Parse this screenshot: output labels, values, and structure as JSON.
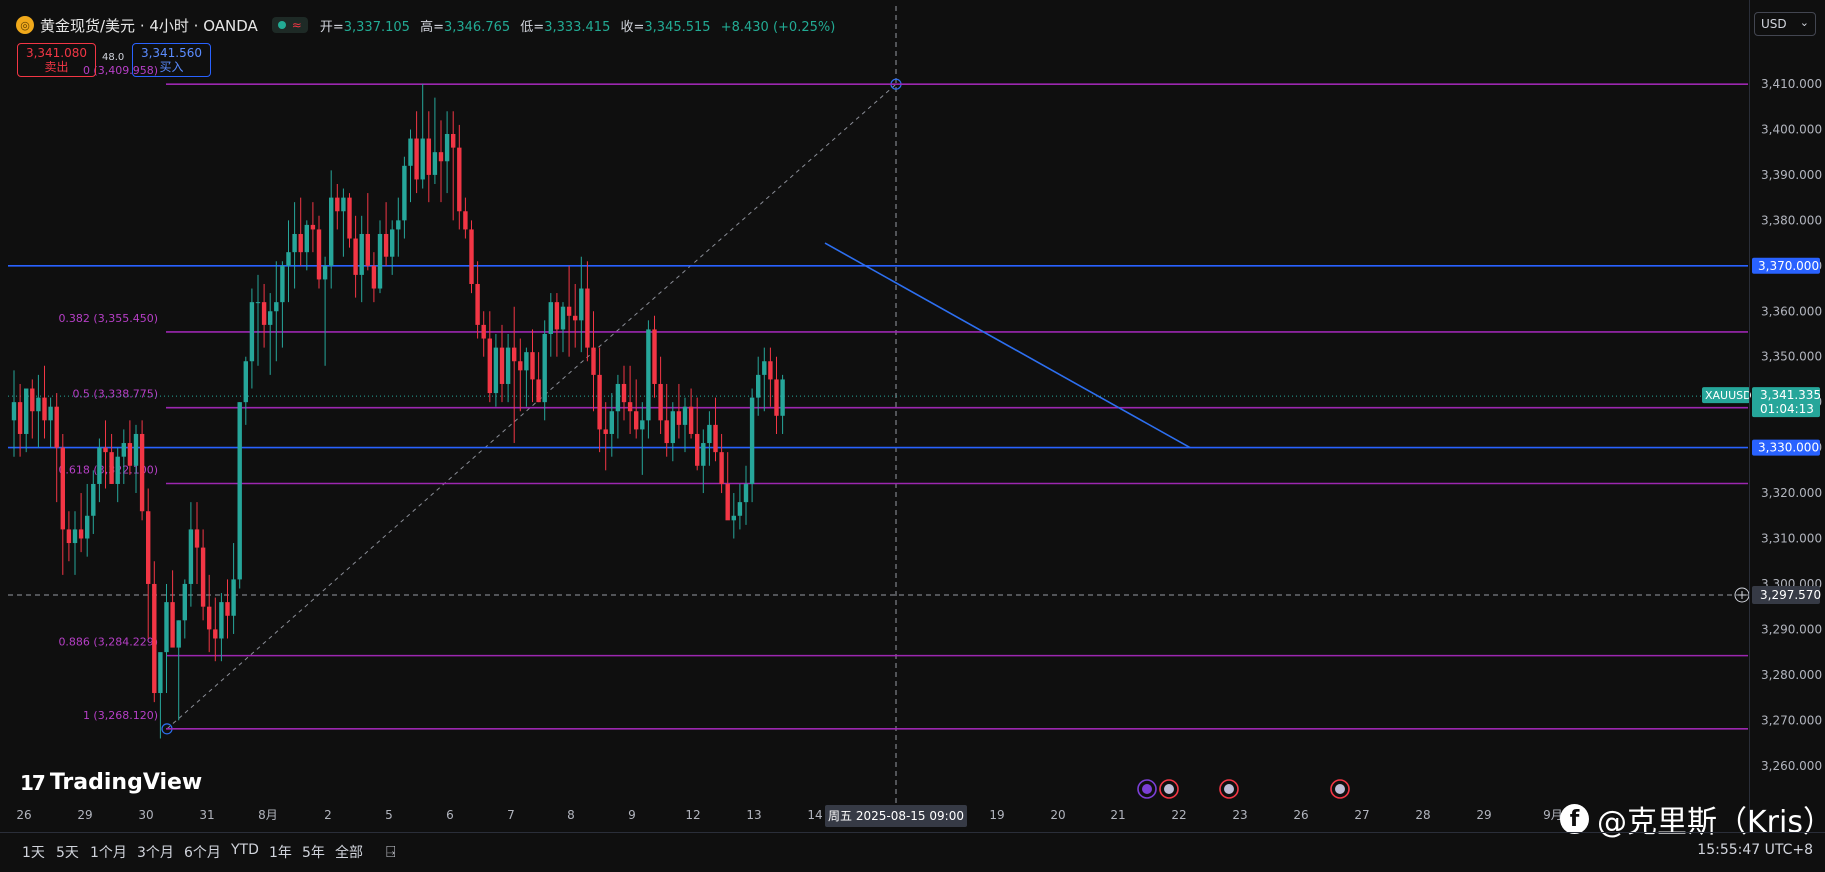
{
  "header": {
    "symbol_title": "黄金现货/美元 · 4小时 · OANDA",
    "ohlc": [
      {
        "label": "开=",
        "value": "3,337.105"
      },
      {
        "label": "高=",
        "value": "3,346.765"
      },
      {
        "label": "低=",
        "value": "3,333.415"
      },
      {
        "label": "收=",
        "value": "3,345.515"
      },
      {
        "label": "",
        "value": "+8.430 (+0.25%)"
      }
    ]
  },
  "trade": {
    "sell_price": "3,341.080",
    "sell_label": "卖出",
    "spread": "48.0",
    "buy_price": "3,341.560",
    "buy_label": "买入"
  },
  "currency": "USD",
  "timeframes": [
    "1天",
    "5天",
    "1个月",
    "3个月",
    "6个月",
    "YTD",
    "1年",
    "5年",
    "全部"
  ],
  "clock": "15:55:47 UTC+8",
  "branding": {
    "logo_text": "TradingView",
    "logo_mark": "17"
  },
  "watermark": "@克里斯（Kris）",
  "colors": {
    "up": "#26a69a",
    "down": "#f23645",
    "fib": "#9c27b0",
    "level": "#2962ff",
    "trend": "#2d6ff0"
  },
  "chart_data": {
    "type": "candlestick",
    "symbol": "XAUUSD",
    "interval": "4h",
    "y_axis": {
      "ticks": [
        "3,260.000",
        "3,270.000",
        "3,280.000",
        "3,290.000",
        "3,300.000",
        "3,310.000",
        "3,320.000",
        "3,330.000",
        "3,340.000",
        "3,350.000",
        "3,360.000",
        "3,370.000",
        "3,380.000",
        "3,390.000",
        "3,400.000",
        "3,410.000"
      ],
      "range": [
        3255,
        3415
      ]
    },
    "x_axis": {
      "labels": [
        "26",
        "29",
        "30",
        "31",
        "8月",
        "2",
        "5",
        "6",
        "7",
        "8",
        "9",
        "12",
        "13",
        "14",
        "19",
        "20",
        "21",
        "22",
        "23",
        "26",
        "27",
        "28",
        "29",
        "9月"
      ],
      "crosshair_label": "周五 2025-08-15   09:00"
    },
    "fib_levels": [
      {
        "label": "0 (3,409.958)",
        "price": 3409.958
      },
      {
        "label": "0.382 (3,355.450)",
        "price": 3355.45
      },
      {
        "label": "0.5 (3,338.775)",
        "price": 3338.775
      },
      {
        "label": "0.618 (3,322.100)",
        "price": 3322.1
      },
      {
        "label": "0.886 (3,284.229)",
        "price": 3284.229
      },
      {
        "label": "1 (3,268.120)",
        "price": 3268.12
      }
    ],
    "horizontal_levels": [
      {
        "label": "3,370.000",
        "price": 3370.0
      },
      {
        "label": "3,330.000",
        "price": 3330.0
      }
    ],
    "trendline": {
      "from": {
        "x_index": 131,
        "price": 3375
      },
      "to": {
        "x_index": 190,
        "price": 3330
      }
    },
    "fib_anchor_line": {
      "from": {
        "x_index": 25,
        "price": 3268.12
      },
      "to": {
        "x_index": 141,
        "price": 3409.958
      }
    },
    "last_price": {
      "symbol": "XAUUSD",
      "price_label": "3,341.335",
      "countdown": "01:04:13",
      "price": 3341.335
    },
    "crosshair": {
      "price_label": "3,297.570",
      "price": 3297.57
    },
    "candles_ohlc": [
      [
        3336,
        3347,
        3328,
        3340
      ],
      [
        3340,
        3344,
        3328,
        3333
      ],
      [
        3333,
        3342,
        3329,
        3343
      ],
      [
        3343,
        3345,
        3332,
        3338
      ],
      [
        3338,
        3346,
        3330,
        3341
      ],
      [
        3341,
        3348,
        3332,
        3336
      ],
      [
        3336,
        3341,
        3330,
        3339
      ],
      [
        3339,
        3342,
        3318,
        3330
      ],
      [
        3330,
        3333,
        3302,
        3312
      ],
      [
        3312,
        3316,
        3305,
        3309
      ],
      [
        3309,
        3316,
        3302,
        3312
      ],
      [
        3312,
        3320,
        3307,
        3310
      ],
      [
        3310,
        3322,
        3306,
        3315
      ],
      [
        3315,
        3325,
        3311,
        3322
      ],
      [
        3322,
        3332,
        3318,
        3330
      ],
      [
        3330,
        3336,
        3321,
        3329
      ],
      [
        3329,
        3333,
        3322,
        3322
      ],
      [
        3322,
        3330,
        3318,
        3328
      ],
      [
        3328,
        3334,
        3322,
        3331
      ],
      [
        3331,
        3336,
        3324,
        3326
      ],
      [
        3326,
        3335,
        3320,
        3333
      ],
      [
        3333,
        3336,
        3314,
        3316
      ],
      [
        3316,
        3321,
        3288,
        3300
      ],
      [
        3300,
        3305,
        3274,
        3276
      ],
      [
        3276,
        3282,
        3266,
        3285
      ],
      [
        3285,
        3300,
        3276,
        3296
      ],
      [
        3296,
        3303,
        3290,
        3286
      ],
      [
        3286,
        3292,
        3270,
        3292
      ],
      [
        3292,
        3301,
        3288,
        3300
      ],
      [
        3300,
        3318,
        3295,
        3312
      ],
      [
        3312,
        3318,
        3300,
        3308
      ],
      [
        3308,
        3312,
        3292,
        3295
      ],
      [
        3295,
        3302,
        3285,
        3290
      ],
      [
        3290,
        3297,
        3283,
        3288
      ],
      [
        3288,
        3298,
        3283,
        3296
      ],
      [
        3296,
        3301,
        3288,
        3293
      ],
      [
        3293,
        3309,
        3289,
        3301
      ],
      [
        3301,
        3340,
        3299,
        3340
      ],
      [
        3340,
        3350,
        3335,
        3349
      ],
      [
        3349,
        3365,
        3343,
        3362
      ],
      [
        3362,
        3368,
        3348,
        3362
      ],
      [
        3362,
        3366,
        3352,
        3357
      ],
      [
        3357,
        3364,
        3346,
        3360
      ],
      [
        3360,
        3371,
        3349,
        3362
      ],
      [
        3362,
        3371,
        3352,
        3370
      ],
      [
        3370,
        3380,
        3362,
        3373
      ],
      [
        3373,
        3384,
        3365,
        3377
      ],
      [
        3377,
        3385,
        3370,
        3373
      ],
      [
        3373,
        3380,
        3369,
        3379
      ],
      [
        3379,
        3384,
        3373,
        3378
      ],
      [
        3378,
        3381,
        3365,
        3367
      ],
      [
        3367,
        3372,
        3348,
        3370
      ],
      [
        3370,
        3391,
        3365,
        3385
      ],
      [
        3385,
        3388,
        3378,
        3382
      ],
      [
        3382,
        3387,
        3372,
        3385
      ],
      [
        3385,
        3386,
        3374,
        3376
      ],
      [
        3376,
        3381,
        3363,
        3368
      ],
      [
        3368,
        3381,
        3362,
        3377
      ],
      [
        3377,
        3386,
        3369,
        3370
      ],
      [
        3370,
        3373,
        3362,
        3365
      ],
      [
        3365,
        3380,
        3364,
        3377
      ],
      [
        3377,
        3384,
        3370,
        3372
      ],
      [
        3372,
        3380,
        3368,
        3378
      ],
      [
        3378,
        3385,
        3372,
        3380
      ],
      [
        3380,
        3394,
        3376,
        3392
      ],
      [
        3392,
        3400,
        3384,
        3398
      ],
      [
        3398,
        3404,
        3386,
        3389
      ],
      [
        3389,
        3410,
        3387,
        3398
      ],
      [
        3398,
        3404,
        3384,
        3390
      ],
      [
        3390,
        3407,
        3388,
        3395
      ],
      [
        3395,
        3402,
        3384,
        3393
      ],
      [
        3393,
        3404,
        3386,
        3399
      ],
      [
        3399,
        3404,
        3380,
        3396
      ],
      [
        3396,
        3401,
        3378,
        3382
      ],
      [
        3382,
        3385,
        3376,
        3378
      ],
      [
        3378,
        3380,
        3364,
        3366
      ],
      [
        3366,
        3371,
        3354,
        3357
      ],
      [
        3357,
        3360,
        3350,
        3354
      ],
      [
        3354,
        3360,
        3340,
        3342
      ],
      [
        3342,
        3355,
        3339,
        3352
      ],
      [
        3352,
        3357,
        3340,
        3344
      ],
      [
        3344,
        3355,
        3340,
        3352
      ],
      [
        3352,
        3361,
        3331,
        3349
      ],
      [
        3349,
        3354,
        3338,
        3347
      ],
      [
        3347,
        3352,
        3339,
        3351
      ],
      [
        3351,
        3356,
        3340,
        3345
      ],
      [
        3345,
        3351,
        3340,
        3340
      ],
      [
        3340,
        3358,
        3336,
        3355
      ],
      [
        3355,
        3364,
        3350,
        3362
      ],
      [
        3362,
        3364,
        3350,
        3356
      ],
      [
        3356,
        3362,
        3351,
        3361
      ],
      [
        3361,
        3370,
        3350,
        3359
      ],
      [
        3359,
        3366,
        3352,
        3358
      ],
      [
        3358,
        3372,
        3351,
        3365
      ],
      [
        3365,
        3371,
        3349,
        3352
      ],
      [
        3352,
        3360,
        3338,
        3346
      ],
      [
        3346,
        3352,
        3329,
        3334
      ],
      [
        3334,
        3340,
        3325,
        3333
      ],
      [
        3333,
        3342,
        3328,
        3338
      ],
      [
        3338,
        3346,
        3332,
        3344
      ],
      [
        3344,
        3348,
        3336,
        3340
      ],
      [
        3340,
        3348,
        3333,
        3338
      ],
      [
        3338,
        3345,
        3332,
        3334
      ],
      [
        3334,
        3340,
        3324,
        3336
      ],
      [
        3336,
        3358,
        3332,
        3356
      ],
      [
        3356,
        3359,
        3341,
        3344
      ],
      [
        3344,
        3350,
        3333,
        3336
      ],
      [
        3336,
        3344,
        3328,
        3331
      ],
      [
        3331,
        3340,
        3327,
        3338
      ],
      [
        3338,
        3344,
        3332,
        3335
      ],
      [
        3335,
        3341,
        3329,
        3339
      ],
      [
        3339,
        3343,
        3332,
        3333
      ],
      [
        3333,
        3341,
        3325,
        3326
      ],
      [
        3326,
        3334,
        3320,
        3331
      ],
      [
        3331,
        3338,
        3326,
        3335
      ],
      [
        3335,
        3341,
        3327,
        3329
      ],
      [
        3329,
        3333,
        3320,
        3322
      ],
      [
        3322,
        3329,
        3315,
        3314
      ],
      [
        3314,
        3320,
        3310,
        3315
      ],
      [
        3315,
        3322,
        3312,
        3318
      ],
      [
        3318,
        3326,
        3313,
        3322
      ],
      [
        3322,
        3343,
        3318,
        3341
      ],
      [
        3341,
        3350,
        3337,
        3346
      ],
      [
        3346,
        3352,
        3338,
        3349
      ],
      [
        3349,
        3352,
        3339,
        3345
      ],
      [
        3345,
        3350,
        3333,
        3337
      ],
      [
        3337,
        3346,
        3333,
        3345
      ]
    ]
  }
}
